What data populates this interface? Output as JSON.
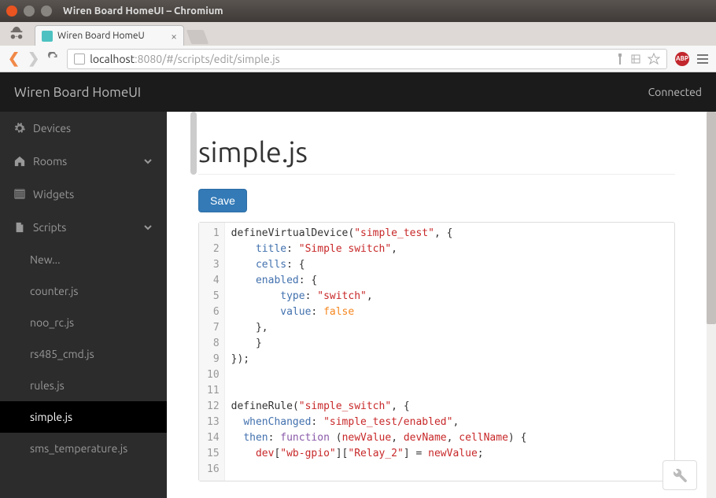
{
  "window": {
    "title": "Wiren Board HomeUI – Chromium"
  },
  "tab": {
    "title": "Wiren Board HomeU"
  },
  "addressbar": {
    "host": "localhost",
    "port_and_path": ":8080/#/scripts/edit/simple.js"
  },
  "header": {
    "brand": "Wiren Board HomeUI",
    "status": "Connected"
  },
  "sidebar": {
    "items": [
      {
        "label": "Devices",
        "icon": "gear"
      },
      {
        "label": "Rooms",
        "icon": "home",
        "expandable": true
      },
      {
        "label": "Widgets",
        "icon": "list"
      },
      {
        "label": "Scripts",
        "icon": "file",
        "expandable": true,
        "expanded": true
      }
    ],
    "script_items": [
      {
        "label": "New..."
      },
      {
        "label": "counter.js"
      },
      {
        "label": "noo_rc.js"
      },
      {
        "label": "rs485_cmd.js"
      },
      {
        "label": "rules.js"
      },
      {
        "label": "simple.js",
        "active": true
      },
      {
        "label": "sms_temperature.js"
      }
    ]
  },
  "page": {
    "title": "simple.js",
    "save_label": "Save"
  },
  "code": {
    "lines": [
      [
        [
          "fn",
          "defineVirtualDevice"
        ],
        [
          "punct",
          "("
        ],
        [
          "str",
          "\"simple_test\""
        ],
        [
          "punct",
          ", {"
        ]
      ],
      [
        [
          "punct",
          "    "
        ],
        [
          "prop",
          "title"
        ],
        [
          "punct",
          ": "
        ],
        [
          "str",
          "\"Simple switch\""
        ],
        [
          "punct",
          ","
        ]
      ],
      [
        [
          "punct",
          "    "
        ],
        [
          "prop",
          "cells"
        ],
        [
          "punct",
          ": {"
        ]
      ],
      [
        [
          "punct",
          "    "
        ],
        [
          "prop",
          "enabled"
        ],
        [
          "punct",
          ": {"
        ]
      ],
      [
        [
          "punct",
          "        "
        ],
        [
          "prop",
          "type"
        ],
        [
          "punct",
          ": "
        ],
        [
          "str",
          "\"switch\""
        ],
        [
          "punct",
          ","
        ]
      ],
      [
        [
          "punct",
          "        "
        ],
        [
          "prop",
          "value"
        ],
        [
          "punct",
          ": "
        ],
        [
          "val",
          "false"
        ]
      ],
      [
        [
          "punct",
          "    },"
        ]
      ],
      [
        [
          "punct",
          "    }"
        ]
      ],
      [
        [
          "punct",
          "});"
        ]
      ],
      [],
      [],
      [
        [
          "fn",
          "defineRule"
        ],
        [
          "punct",
          "("
        ],
        [
          "str",
          "\"simple_switch\""
        ],
        [
          "punct",
          ", {"
        ]
      ],
      [
        [
          "punct",
          "  "
        ],
        [
          "prop",
          "whenChanged"
        ],
        [
          "punct",
          ": "
        ],
        [
          "str",
          "\"simple_test/enabled\""
        ],
        [
          "punct",
          ","
        ]
      ],
      [
        [
          "punct",
          "  "
        ],
        [
          "prop",
          "then"
        ],
        [
          "punct",
          ": "
        ],
        [
          "kw",
          "function"
        ],
        [
          "punct",
          " ("
        ],
        [
          "ident",
          "newValue"
        ],
        [
          "punct",
          ", "
        ],
        [
          "ident",
          "devName"
        ],
        [
          "punct",
          ", "
        ],
        [
          "ident",
          "cellName"
        ],
        [
          "punct",
          ") {"
        ]
      ],
      [
        [
          "punct",
          "    "
        ],
        [
          "ident",
          "dev"
        ],
        [
          "punct",
          "["
        ],
        [
          "str",
          "\"wb-gpio\""
        ],
        [
          "punct",
          "]["
        ],
        [
          "str",
          "\"Relay_2\""
        ],
        [
          "punct",
          "] = "
        ],
        [
          "ident",
          "newValue"
        ],
        [
          "punct",
          ";"
        ]
      ],
      []
    ]
  }
}
